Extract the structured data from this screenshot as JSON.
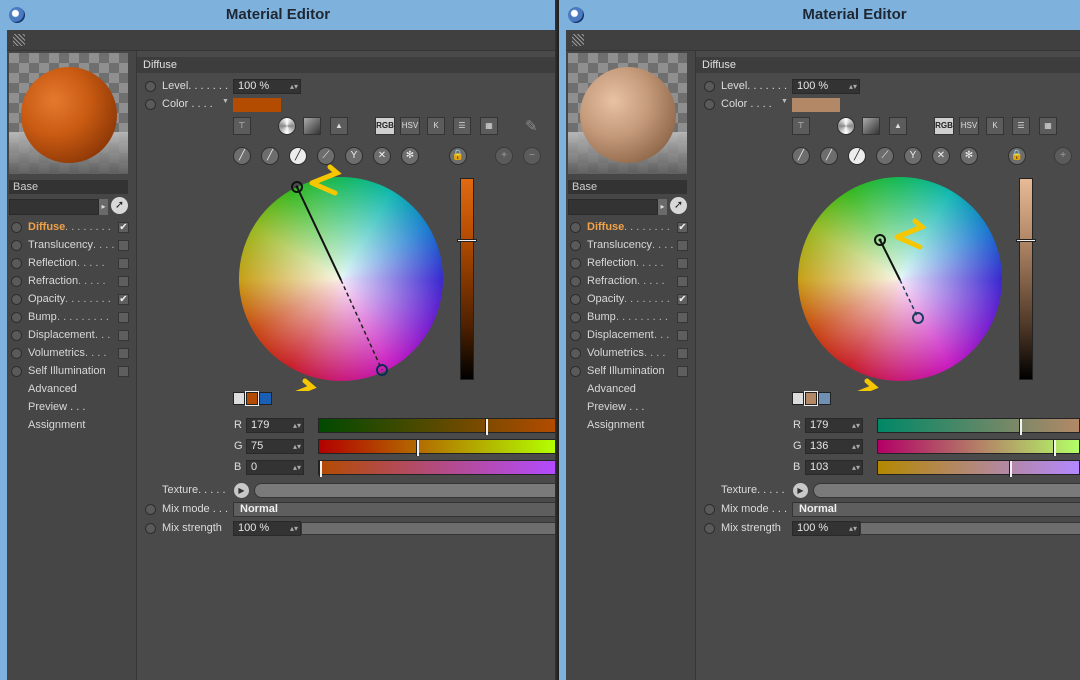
{
  "window_title": "Material Editor",
  "section_header": "Diffuse",
  "base_label": "Base",
  "channels": [
    {
      "label": "Diffuse",
      "dots": " . . . . . . . .",
      "checked": true,
      "active": true
    },
    {
      "label": "Translucency",
      "dots": " . . . .",
      "checked": false
    },
    {
      "label": "Reflection",
      "dots": " . . . . .",
      "checked": false
    },
    {
      "label": "Refraction",
      "dots": " . . . . .",
      "checked": false
    },
    {
      "label": "Opacity",
      "dots": " . . . . . . . .",
      "checked": true
    },
    {
      "label": "Bump",
      "dots": " . . . . . . . . .",
      "checked": false
    },
    {
      "label": "Displacement",
      "dots": " . . .",
      "checked": false
    },
    {
      "label": "Volumetrics",
      "dots": " . . . .",
      "checked": false
    },
    {
      "label": "Self Illumination",
      "dots": "",
      "checked": false
    }
  ],
  "extra_items": [
    "Advanced",
    "Preview . . .",
    "Assignment"
  ],
  "level_label": "Level. . . . . . .",
  "color_label": "Color . . . .",
  "texture_label": "Texture. . . . .",
  "mixmode_label": "Mix mode . . .",
  "mixstrength_label": "Mix strength",
  "mode_buttons": [
    "RGB",
    "HSV",
    "K"
  ],
  "slider_letters": [
    "R",
    "G",
    "B"
  ],
  "panels": [
    {
      "level": "100 %",
      "color_hex": "#b34b00",
      "rgb": [
        179,
        75,
        0
      ],
      "mix_mode": "Normal",
      "mix_strength": "100 %",
      "palette": [
        "#dcdcdc",
        "#b34b00",
        "#1a5fb4"
      ]
    },
    {
      "level": "100 %",
      "color_hex": "#b38867",
      "rgb": [
        179,
        136,
        103
      ],
      "mix_mode": "Normal",
      "mix_strength": "100 %",
      "palette": [
        "#dcdcdc",
        "#b38867",
        "#6f8fb3"
      ]
    }
  ]
}
